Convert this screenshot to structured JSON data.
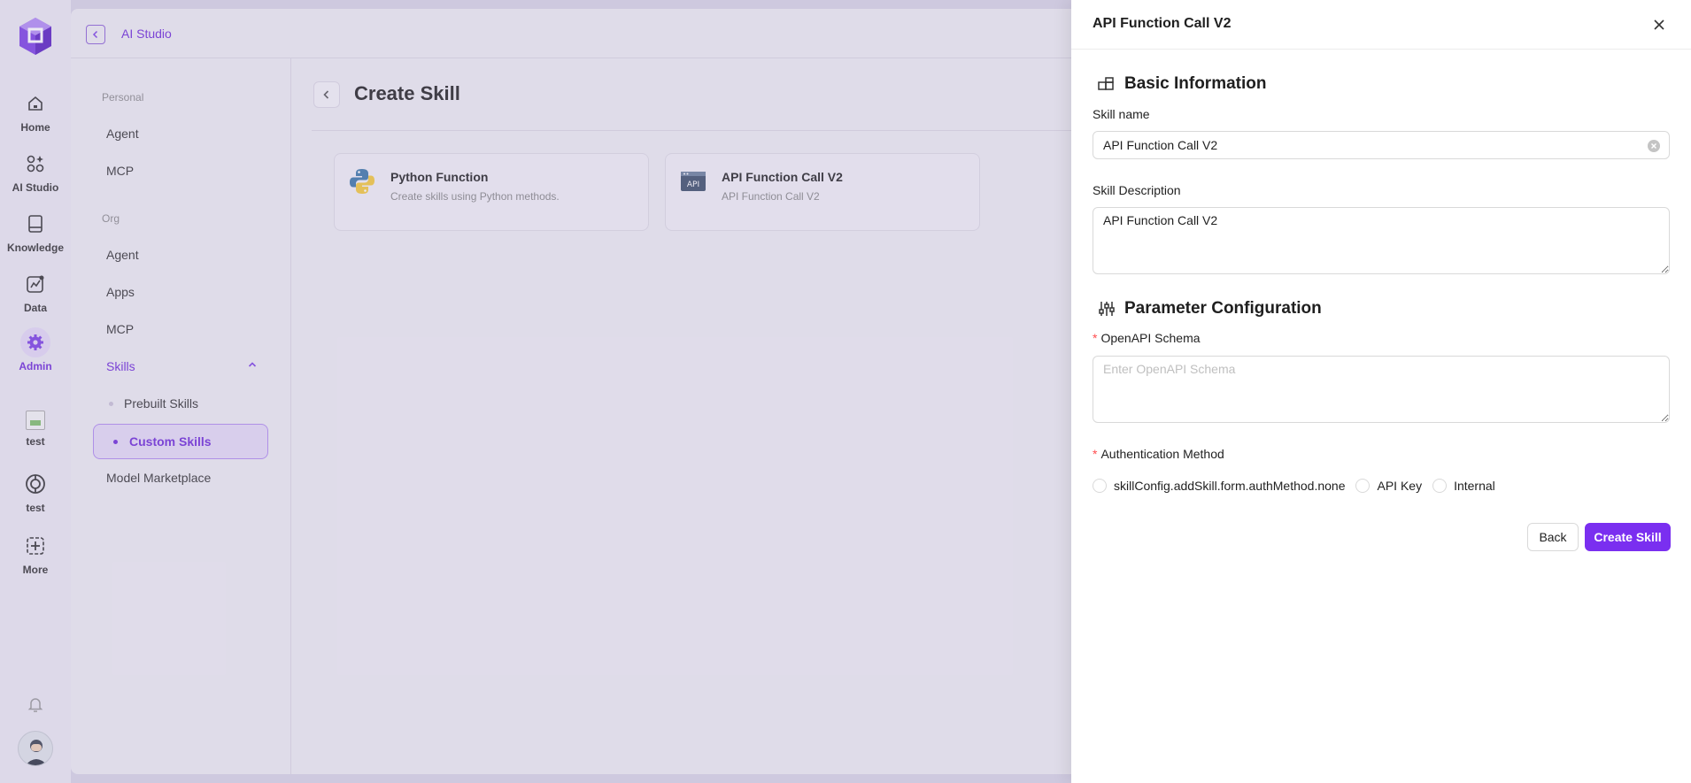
{
  "rail": {
    "items": [
      {
        "label": "Home",
        "icon": "home-icon"
      },
      {
        "label": "AI Studio",
        "icon": "ai-studio-icon"
      },
      {
        "label": "Knowledge",
        "icon": "book-icon"
      },
      {
        "label": "Data",
        "icon": "chart-icon"
      },
      {
        "label": "Admin",
        "icon": "gear-icon"
      },
      {
        "label": "test",
        "icon": "broken-image-icon"
      },
      {
        "label": "test",
        "icon": "openai-icon"
      },
      {
        "label": "More",
        "icon": "plus-square-icon"
      }
    ]
  },
  "header": {
    "app_title": "AI Studio"
  },
  "subnav": {
    "personal_label": "Personal",
    "personal_items": [
      "Agent",
      "MCP"
    ],
    "org_label": "Org",
    "org_items": [
      "Agent",
      "Apps",
      "MCP"
    ],
    "skills_label": "Skills",
    "skills_children": [
      "Prebuilt Skills",
      "Custom Skills"
    ],
    "model_marketplace": "Model Marketplace"
  },
  "content": {
    "title": "Create Skill",
    "cards": [
      {
        "title": "Python Function",
        "desc": "Create skills using Python methods.",
        "icon": "python-icon"
      },
      {
        "title": "API Function Call V2",
        "desc": "API Function Call V2",
        "icon": "api-icon"
      }
    ]
  },
  "drawer": {
    "title": "API Function Call V2",
    "basic_info_heading": "Basic Information",
    "skill_name_label": "Skill name",
    "skill_name_value": "API Function Call V2",
    "skill_desc_label": "Skill Description",
    "skill_desc_value": "API Function Call V2",
    "param_heading": "Parameter Configuration",
    "schema_label": "OpenAPI Schema",
    "schema_placeholder": "Enter OpenAPI Schema",
    "auth_label": "Authentication Method",
    "auth_options": [
      "skillConfig.addSkill.form.authMethod.none",
      "API Key",
      "Internal"
    ],
    "back_label": "Back",
    "create_label": "Create Skill"
  },
  "colors": {
    "accent": "#7a2ff0",
    "required": "#ff4d4f"
  }
}
